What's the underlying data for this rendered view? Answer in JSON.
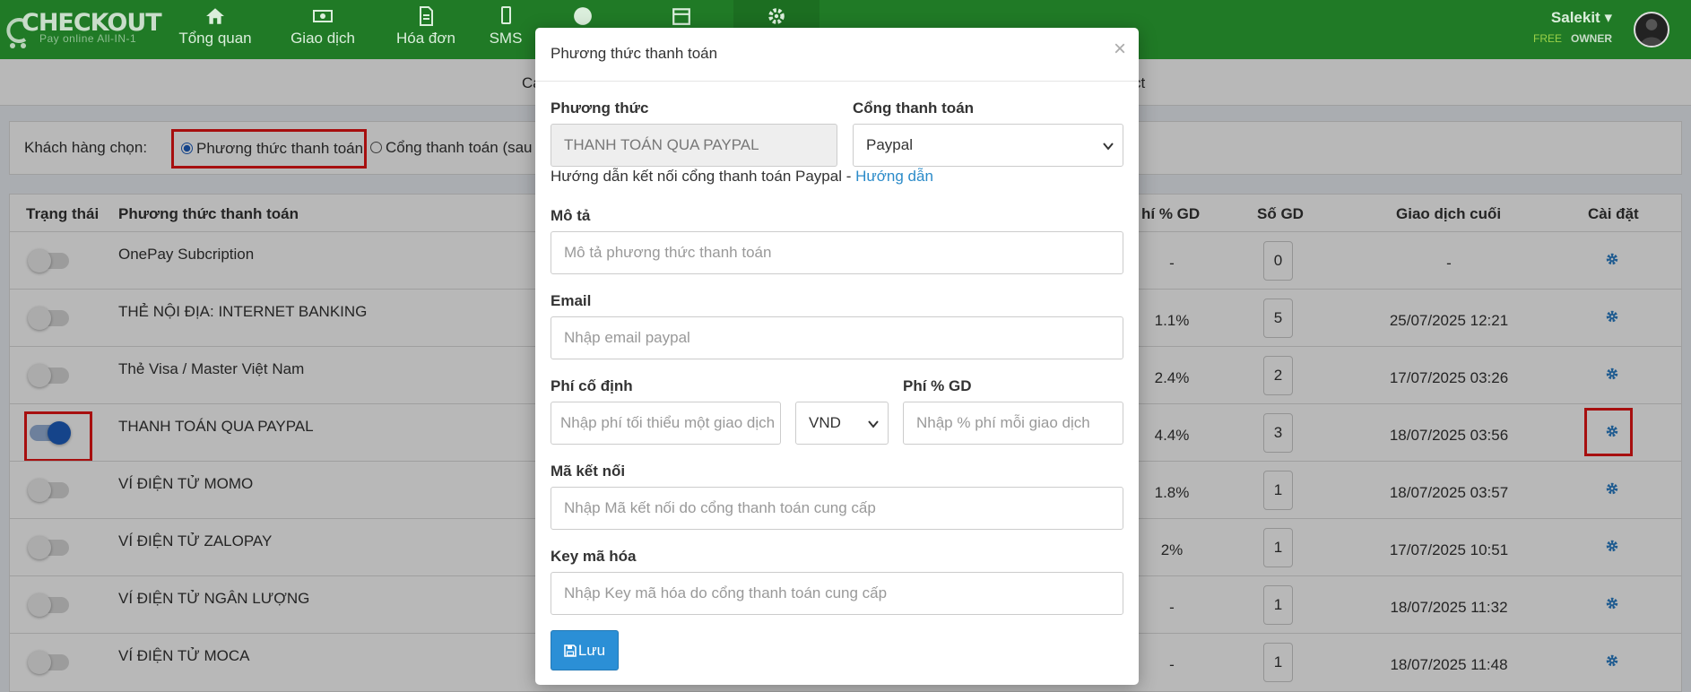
{
  "navbar": {
    "brand": "CHECKOUT",
    "tagline": "Pay online All-IN-1",
    "items": [
      {
        "label": "Tổng quan",
        "icon": "home-icon"
      },
      {
        "label": "Giao dịch",
        "icon": "money-icon"
      },
      {
        "label": "Hóa đơn",
        "icon": "document-icon"
      },
      {
        "label": "SMS",
        "icon": "mobile-icon"
      },
      {
        "label": "",
        "icon": "globe-icon"
      },
      {
        "label": "",
        "icon": "calendar-icon"
      },
      {
        "label": "",
        "icon": "gear-icon"
      }
    ],
    "user": {
      "name": "Salekit",
      "plan": "FREE",
      "role": "OWNER"
    }
  },
  "subbar": {
    "left_text": "Ca",
    "right_text": "ct"
  },
  "customer_choice": {
    "label": "Khách hàng chọn:",
    "option1": "Phương thức thanh toán",
    "option2": "Cổng thanh toán (sau đó"
  },
  "table": {
    "headers": {
      "status": "Trạng thái",
      "method": "Phương thức thanh toán",
      "fee_pct": "hí % GD",
      "count": "Số GD",
      "last": "Giao dịch cuối",
      "settings": "Cài đặt"
    },
    "rows": [
      {
        "name": "OnePay Subcription",
        "enabled": false,
        "fee_pct": "-",
        "count": "0",
        "last": "-"
      },
      {
        "name": "THẺ NỘI ĐỊA: INTERNET BANKING",
        "enabled": false,
        "fee_pct": "1.1%",
        "count": "5",
        "last": "25/07/2025 12:21"
      },
      {
        "name": "Thẻ Visa / Master Việt Nam",
        "enabled": false,
        "fee_pct": "2.4%",
        "count": "2",
        "last": "17/07/2025 03:26"
      },
      {
        "name": "THANH TOÁN QUA PAYPAL",
        "enabled": true,
        "fee_pct": "4.4%",
        "count": "3",
        "last": "18/07/2025 03:56"
      },
      {
        "name": "VÍ ĐIỆN TỬ MOMO",
        "enabled": false,
        "fee_pct": "1.8%",
        "count": "1",
        "last": "18/07/2025 03:57"
      },
      {
        "name": "VÍ ĐIỆN TỬ ZALOPAY",
        "enabled": false,
        "fee_pct": "2%",
        "count": "1",
        "last": "17/07/2025 10:51"
      },
      {
        "name": "VÍ ĐIỆN TỬ NGÂN LƯỢNG",
        "enabled": false,
        "fee_pct": "-",
        "count": "1",
        "last": "18/07/2025 11:32"
      },
      {
        "name": "VÍ ĐIỆN TỬ MOCA",
        "enabled": false,
        "fee_pct": "-",
        "count": "1",
        "last": "18/07/2025 11:48"
      }
    ]
  },
  "modal": {
    "title": "Phương thức thanh toán",
    "close": "×",
    "method_label": "Phương thức",
    "method_value": "THANH TOÁN QUA PAYPAL",
    "gateway_label": "Cổng thanh toán",
    "gateway_value": "Paypal",
    "helper_text": "Hướng dẫn kết nối cổng thanh toán Paypal - ",
    "helper_link": "Hướng dẫn",
    "desc_label": "Mô tả",
    "desc_placeholder": "Mô tả phương thức thanh toán",
    "email_label": "Email",
    "email_placeholder": "Nhập email paypal",
    "fixed_fee_label": "Phí cố định",
    "fixed_fee_placeholder": "Nhập phí tối thiểu một giao dịch",
    "currency_value": "VND",
    "pct_fee_label": "Phí % GD",
    "pct_fee_placeholder": "Nhập % phí mỗi giao dịch",
    "conn_label": "Mã kết nối",
    "conn_placeholder": "Nhập Mã kết nối do cổng thanh toán cung cấp",
    "key_label": "Key mã hóa",
    "key_placeholder": "Nhập Key mã hóa do cổng thanh toán cung cấp",
    "save_label": "Lưu"
  },
  "colors": {
    "navbar": "#207a26",
    "primary": "#2b8fd6",
    "highlight": "#e81515",
    "toggle_on": "#1e5fbf"
  }
}
